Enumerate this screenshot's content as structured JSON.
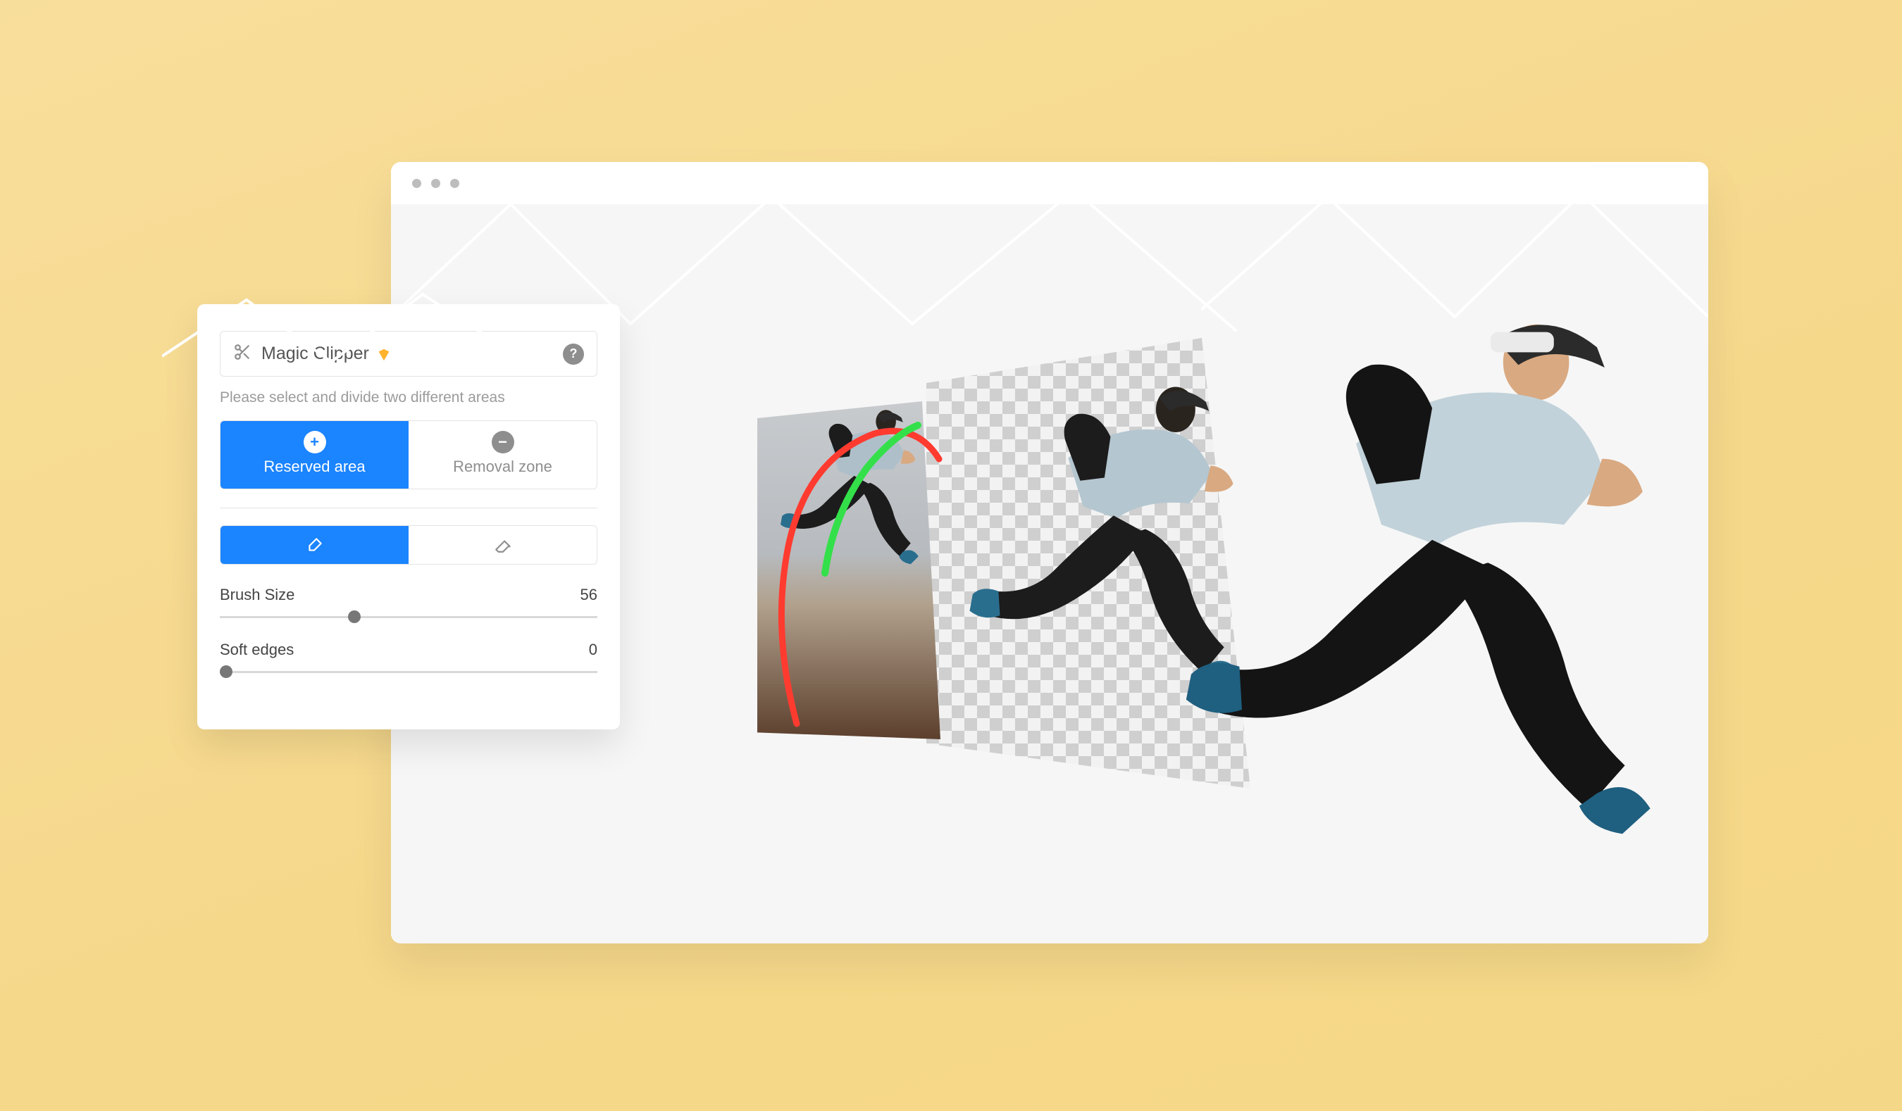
{
  "panel": {
    "title": "Magic Clipper",
    "badge_icon": "diamond-icon",
    "help_text": "Please select and divide two different areas",
    "modes": {
      "reserve": {
        "label": "Reserved area",
        "icon": "plus-icon"
      },
      "remove": {
        "label": "Removal zone",
        "icon": "minus-icon"
      }
    },
    "tools": {
      "brush": "brush-icon",
      "eraser": "eraser-icon"
    },
    "brush_size": {
      "label": "Brush Size",
      "value": "56",
      "pct": 34
    },
    "soft_edges": {
      "label": "Soft edges",
      "value": "0",
      "pct": 0
    }
  },
  "canvas": {
    "strokes": {
      "keep_color": "#34e04a",
      "remove_color": "#ff3b30"
    },
    "subject": "jumping-person"
  }
}
